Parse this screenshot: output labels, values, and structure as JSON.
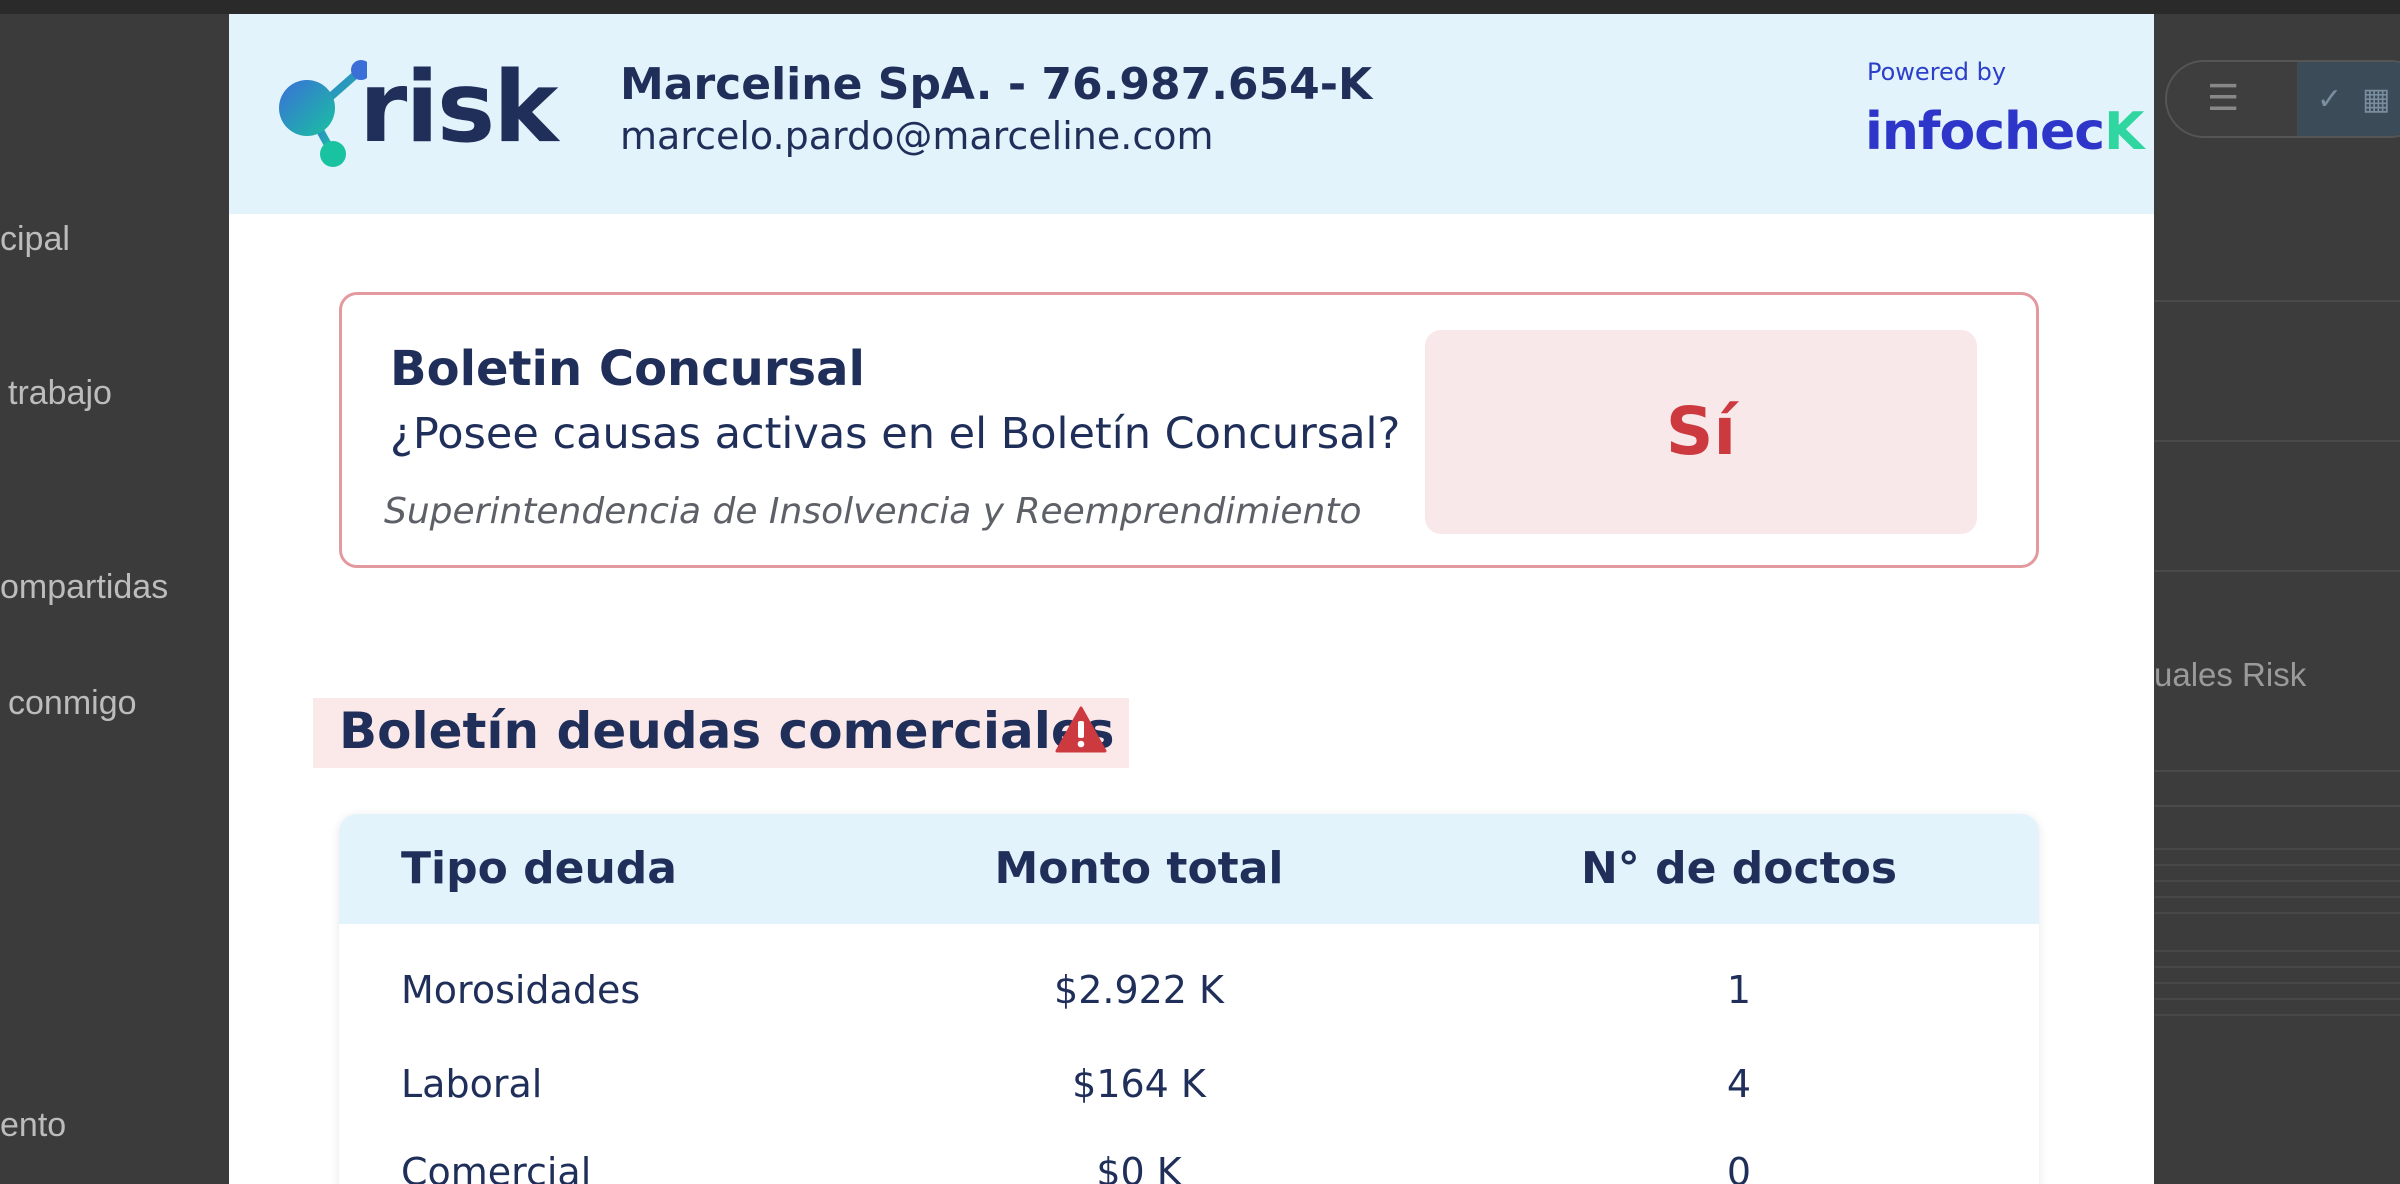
{
  "background": {
    "nav_items": [
      "cipal",
      "trabajo",
      "ompartidas",
      "conmigo",
      "ento"
    ],
    "right_title": "uales Risk"
  },
  "header": {
    "logo_text": "risk",
    "company": "Marceline SpA. - 76.987.654-K",
    "email": "marcelo.pardo@marceline.com",
    "powered_by": "Powered by",
    "brand_main": "infochec",
    "brand_accent": "K"
  },
  "concursal": {
    "title": "Boletin Concursal",
    "question": "¿Posee causas activas en el Boletín Concursal?",
    "source": "Superintendencia de Insolvencia y Reemprendimiento",
    "answer": "Sí"
  },
  "deudas": {
    "title": "Boletín deudas comerciales",
    "warning_icon": "warning-icon",
    "columns": [
      "Tipo deuda",
      "Monto total",
      "N° de doctos"
    ],
    "rows": [
      {
        "tipo": "Morosidades",
        "monto": "$2.922 K",
        "doctos": "1"
      },
      {
        "tipo": "Laboral",
        "monto": "$164 K",
        "doctos": "4"
      },
      {
        "tipo": "Comercial",
        "monto": "$0 K",
        "doctos": "0"
      }
    ]
  },
  "colors": {
    "header_bg": "#e3f3fc",
    "navy": "#1f2f5a",
    "alert_red": "#cc3a40",
    "alert_bg": "#f8e8ea",
    "infocheck_blue": "#2d36c8",
    "infocheck_green": "#2fd6a0"
  }
}
